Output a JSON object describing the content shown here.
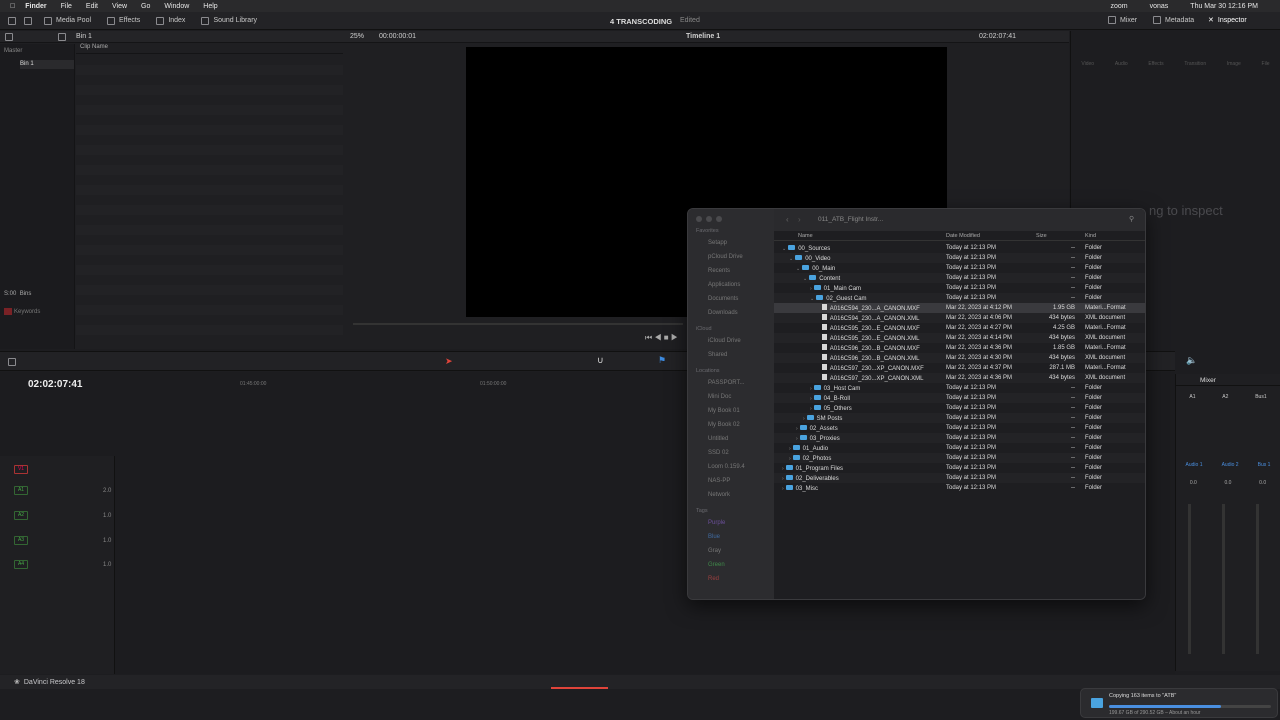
{
  "menubar": {
    "apple": "",
    "items": [
      "Finder",
      "File",
      "Edit",
      "View",
      "Go",
      "Window",
      "Help"
    ],
    "right": [
      "zoom",
      "vonas",
      "Thu Mar 30  12:16 PM"
    ]
  },
  "toolbar": {
    "media_pool": "Media Pool",
    "effects": "Effects",
    "index": "Index",
    "sound_library": "Sound Library",
    "project": "4 TRANSCODING",
    "status": "Edited",
    "mixer": "Mixer",
    "metadata": "Metadata",
    "inspector": "Inspector"
  },
  "media": {
    "bin": "Bin 1",
    "master": "Master",
    "bin_item": "Bin 1",
    "clip_name": "Clip Name",
    "zoom": "25%",
    "tc": "00:00:00:01",
    "timeline": "Timeline 1",
    "tc_right": "02:02:07:41",
    "smart_bins": "Bins",
    "keywords": "Keywords",
    "smart_prefix": "S:00"
  },
  "inspector": {
    "tabs": [
      "Video",
      "Audio",
      "Effects",
      "Transition",
      "Image",
      "File"
    ],
    "hint": "ng to inspect"
  },
  "timeline": {
    "tc": "02:02:07:41",
    "ruler": [
      "01:45:00:00",
      "01:50:00:00"
    ],
    "tracks": [
      {
        "name": "V1",
        "level": ""
      },
      {
        "name": "A1",
        "level": "2.0"
      },
      {
        "name": "A2",
        "level": "1.0"
      },
      {
        "name": "A3",
        "level": "1.0"
      },
      {
        "name": "A4",
        "level": "1.0"
      }
    ]
  },
  "finder": {
    "title": "011_ATB_Flight Instr...",
    "sidebar": {
      "favorites": "Favorites",
      "fav": [
        "Setapp",
        "pCloud Drive",
        "Recents",
        "Applications",
        "Documents",
        "Downloads"
      ],
      "icloud": "iCloud",
      "ic": [
        "iCloud Drive",
        "Shared"
      ],
      "locations": "Locations",
      "loc": [
        "PASSPORT...",
        "Mini Doc",
        "My Book 01",
        "My Book 02",
        "Untitled",
        "SSD 02",
        "Loom 0.159.4",
        "NAS-PP",
        "Network"
      ],
      "tags": "Tags",
      "tg": [
        "Purple",
        "Blue",
        "Gray",
        "Green",
        "Red"
      ]
    },
    "columns": {
      "name": "Name",
      "date": "Date Modified",
      "size": "Size",
      "kind": "Kind"
    },
    "rows": [
      {
        "name": "00_Sources",
        "date": "Today at 12:13 PM",
        "size": "--",
        "kind": "Folder",
        "indent": 0,
        "type": "folder",
        "open": true
      },
      {
        "name": "00_Video",
        "date": "Today at 12:13 PM",
        "size": "--",
        "kind": "Folder",
        "indent": 1,
        "type": "folder",
        "open": true
      },
      {
        "name": "00_Main",
        "date": "Today at 12:13 PM",
        "size": "--",
        "kind": "Folder",
        "indent": 2,
        "type": "folder",
        "open": true
      },
      {
        "name": "Content",
        "date": "Today at 12:13 PM",
        "size": "--",
        "kind": "Folder",
        "indent": 3,
        "type": "folder",
        "open": true
      },
      {
        "name": "01_Main Cam",
        "date": "Today at 12:13 PM",
        "size": "--",
        "kind": "Folder",
        "indent": 4,
        "type": "folder"
      },
      {
        "name": "02_Guest Cam",
        "date": "Today at 12:13 PM",
        "size": "--",
        "kind": "Folder",
        "indent": 4,
        "type": "folder",
        "open": true
      },
      {
        "name": "A016C594_230...A_CANON.MXF",
        "date": "Mar 22, 2023 at 4:12 PM",
        "size": "1.95 GB",
        "kind": "Materi...Format",
        "indent": 5,
        "type": "doc"
      },
      {
        "name": "A016C594_230...A_CANON.XML",
        "date": "Mar 22, 2023 at 4:06 PM",
        "size": "434 bytes",
        "kind": "XML document",
        "indent": 5,
        "type": "doc"
      },
      {
        "name": "A016C595_230...E_CANON.MXF",
        "date": "Mar 22, 2023 at 4:27 PM",
        "size": "4.25 GB",
        "kind": "Materi...Format",
        "indent": 5,
        "type": "doc"
      },
      {
        "name": "A016C595_230...E_CANON.XML",
        "date": "Mar 22, 2023 at 4:14 PM",
        "size": "434 bytes",
        "kind": "XML document",
        "indent": 5,
        "type": "doc"
      },
      {
        "name": "A016C596_230...B_CANON.MXF",
        "date": "Mar 22, 2023 at 4:36 PM",
        "size": "1.85 GB",
        "kind": "Materi...Format",
        "indent": 5,
        "type": "doc"
      },
      {
        "name": "A016C596_230...B_CANON.XML",
        "date": "Mar 22, 2023 at 4:30 PM",
        "size": "434 bytes",
        "kind": "XML document",
        "indent": 5,
        "type": "doc"
      },
      {
        "name": "A016C597_230...XP_CANON.MXF",
        "date": "Mar 22, 2023 at 4:37 PM",
        "size": "287.1 MB",
        "kind": "Materi...Format",
        "indent": 5,
        "type": "doc"
      },
      {
        "name": "A016C597_230...XP_CANON.XML",
        "date": "Mar 22, 2023 at 4:36 PM",
        "size": "434 bytes",
        "kind": "XML document",
        "indent": 5,
        "type": "doc"
      },
      {
        "name": "03_Host Cam",
        "date": "Today at 12:13 PM",
        "size": "--",
        "kind": "Folder",
        "indent": 4,
        "type": "folder"
      },
      {
        "name": "04_B-Roll",
        "date": "Today at 12:13 PM",
        "size": "--",
        "kind": "Folder",
        "indent": 4,
        "type": "folder"
      },
      {
        "name": "05_Others",
        "date": "Today at 12:13 PM",
        "size": "--",
        "kind": "Folder",
        "indent": 4,
        "type": "folder"
      },
      {
        "name": "SM Posts",
        "date": "Today at 12:13 PM",
        "size": "--",
        "kind": "Folder",
        "indent": 3,
        "type": "folder"
      },
      {
        "name": "02_Assets",
        "date": "Today at 12:13 PM",
        "size": "--",
        "kind": "Folder",
        "indent": 2,
        "type": "folder"
      },
      {
        "name": "03_Proxies",
        "date": "Today at 12:13 PM",
        "size": "--",
        "kind": "Folder",
        "indent": 2,
        "type": "folder"
      },
      {
        "name": "01_Audio",
        "date": "Today at 12:13 PM",
        "size": "--",
        "kind": "Folder",
        "indent": 1,
        "type": "folder"
      },
      {
        "name": "02_Photos",
        "date": "Today at 12:13 PM",
        "size": "--",
        "kind": "Folder",
        "indent": 1,
        "type": "folder"
      },
      {
        "name": "01_Program Files",
        "date": "Today at 12:13 PM",
        "size": "--",
        "kind": "Folder",
        "indent": 0,
        "type": "folder"
      },
      {
        "name": "02_Deliverables",
        "date": "Today at 12:13 PM",
        "size": "--",
        "kind": "Folder",
        "indent": 0,
        "type": "folder"
      },
      {
        "name": "03_Misc",
        "date": "Today at 12:13 PM",
        "size": "--",
        "kind": "Folder",
        "indent": 0,
        "type": "folder"
      }
    ]
  },
  "mixer": {
    "title": "Mixer",
    "channels": [
      "A1",
      "A2",
      "Bus1"
    ],
    "labels": [
      "Audio 1",
      "Audio 2",
      "Bus 1"
    ],
    "values": [
      "0.0",
      "0.0",
      "0.0"
    ]
  },
  "copy": {
    "title": "Copying 163 items to \"ATB\"",
    "detail": "199.67 GB of 290.52 GB – About an hour"
  },
  "app": {
    "name": "DaVinci Resolve 18"
  }
}
